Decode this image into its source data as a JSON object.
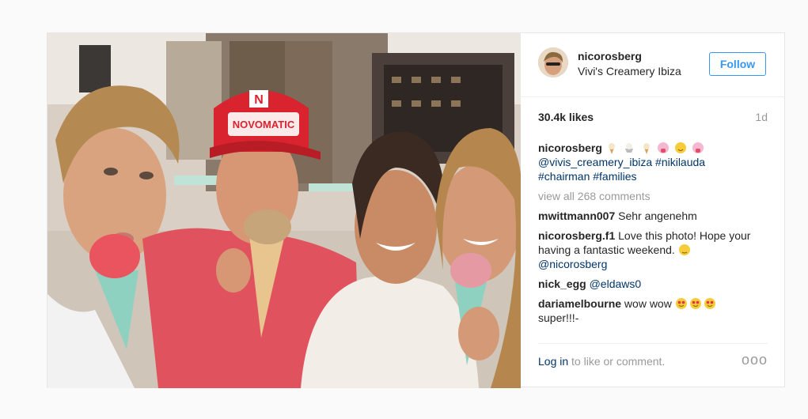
{
  "header": {
    "username": "nicorosberg",
    "location": "Vivi's Creamery Ibiza",
    "follow_label": "Follow"
  },
  "stats": {
    "likes": "30.4k likes",
    "age": "1d"
  },
  "caption": {
    "author": "nicorosberg",
    "emojis": [
      "ice-cream-icon",
      "sundae-icon",
      "ice-cream-icon",
      "tongue-face-icon",
      "blush-face-icon",
      "tongue-face-icon"
    ],
    "line1": "@vivis_creamery_ibiza #nikilauda",
    "line2": "#chairman #families"
  },
  "view_all": "view all 268 comments",
  "comments": [
    {
      "user": "mwittmann007",
      "text": "Sehr angenehm"
    },
    {
      "user": "nicorosberg.f1",
      "text": "Love this photo! Hope your having a fantastic weekend. ",
      "mention": "@nicorosberg"
    },
    {
      "user": "nick_egg",
      "mention": "@eldaws0"
    },
    {
      "user": "dariamelbourne",
      "text": "wow wow ",
      "text2": "super!!!-"
    }
  ],
  "footer": {
    "login_link": "Log in",
    "login_rest": " to like or comment.",
    "more": "ooo"
  },
  "colors": {
    "follow_blue": "#3897f0",
    "link_blue": "#003569",
    "muted": "#999999",
    "cap_red": "#d9232f"
  }
}
